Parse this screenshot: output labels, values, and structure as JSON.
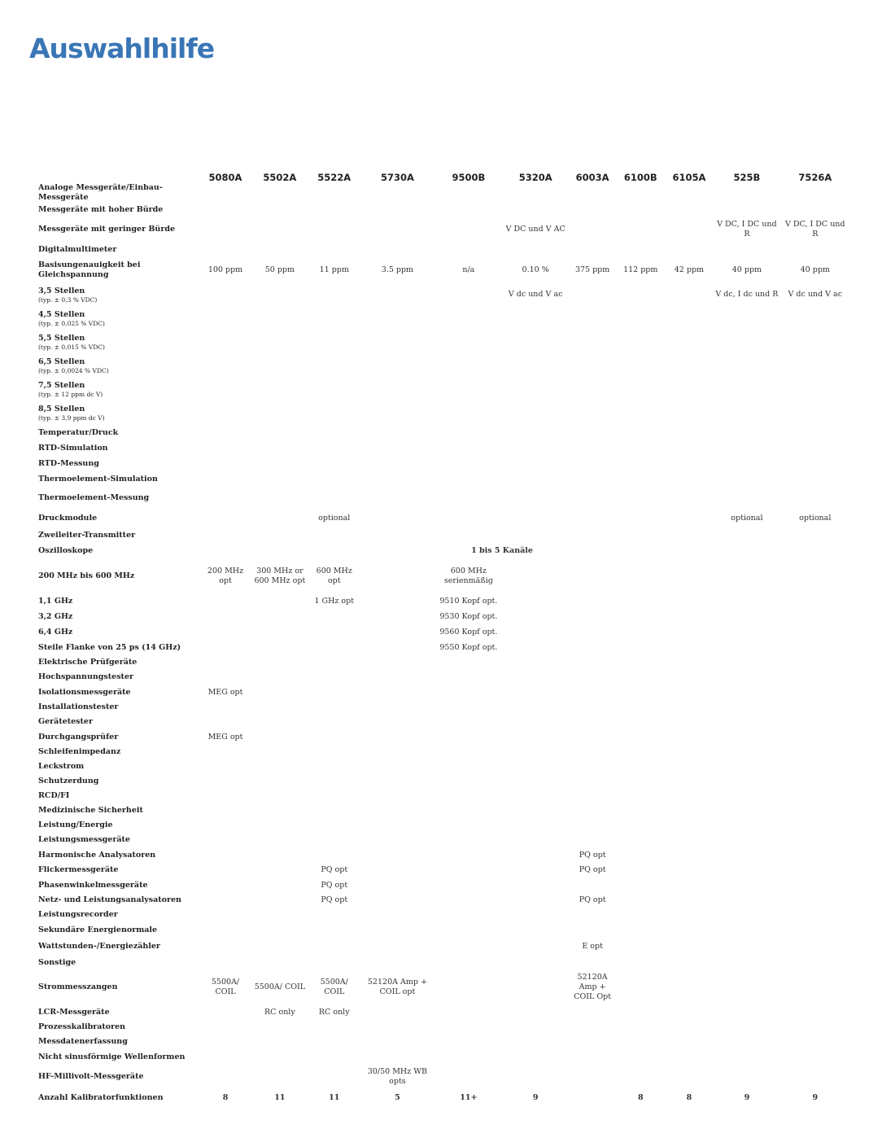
{
  "title": "Auswahlhilfe",
  "columns": [
    "5080A",
    "5502A",
    "5522A",
    "5730A",
    "9500B",
    "5320A",
    "6003A",
    "6100B",
    "6105A",
    "525B",
    "7526A"
  ],
  "rows": [
    {
      "label": "Analoge Messgeräte/Einbau-Messgeräte",
      "h": 18,
      "cells": {}
    },
    {
      "label": "Messgeräte mit hoher Bürde",
      "h": 18,
      "cells": {}
    },
    {
      "label": "Messgeräte mit geringer Bürde",
      "h": 30,
      "cells": {
        "5": "V DC und V AC",
        "9": "V DC, I DC und R",
        "10": "V DC, I DC und R"
      }
    },
    {
      "label": "Digitalmultimeter",
      "h": 20,
      "cells": {}
    },
    {
      "label": "Basisungenauigkeit bei Gleichspannung",
      "h": 30,
      "cells": {
        "0": "100 ppm",
        "1": "50 ppm",
        "2": "11 ppm",
        "3": "3.5 ppm",
        "4": "n/a",
        "5": "0.10 %",
        "6": "375 ppm",
        "7": "112 ppm",
        "8": "42 ppm",
        "9": "40 ppm",
        "10": "40 ppm"
      }
    },
    {
      "label": "3,5 Stellen",
      "sub": "(typ. ± 0,3 % VDC)",
      "h": 30,
      "cells": {
        "5": "V dc und V ac",
        "9": "V dc, I dc und R",
        "10": "V dc und V ac"
      }
    },
    {
      "label": "4,5 Stellen",
      "sub": "(typ. ± 0,025 % VDC)",
      "h": 29,
      "cells": {}
    },
    {
      "label": "5,5 Stellen",
      "sub": "(typ. ± 0,015 % VDC)",
      "h": 29,
      "cells": {}
    },
    {
      "label": "6,5 Stellen",
      "sub": "(typ. ± 0,0024 % VDC)",
      "h": 29,
      "cells": {}
    },
    {
      "label": "7,5 Stellen",
      "sub": "(typ. ± 12 ppm dc V)",
      "h": 29,
      "cells": {}
    },
    {
      "label": "8,5 Stellen",
      "sub": "(typ. ± 3,9 ppm dc V)",
      "h": 29,
      "cells": {}
    },
    {
      "label": "Temperatur/Druck",
      "h": 19,
      "cells": {}
    },
    {
      "label": "RTD-Simulation",
      "h": 19,
      "cells": {}
    },
    {
      "label": "RTD-Messung",
      "h": 19,
      "cells": {}
    },
    {
      "label": "Thermoelement-Simulation",
      "h": 19,
      "cells": {}
    },
    {
      "label": "Thermoelement-Messung",
      "h": 28,
      "cells": {}
    },
    {
      "label": "Druckmodule",
      "h": 22,
      "cells": {
        "2": "optional",
        "9": "optional",
        "10": "optional"
      }
    },
    {
      "label": "Zweileiter-Transmitter",
      "h": 19,
      "cells": {}
    },
    {
      "label": "Oszilloskope",
      "h": 19,
      "span": {
        "start": 4,
        "len": 2,
        "text": "1 bis 5 Kanäle"
      },
      "cells": {}
    },
    {
      "label": "200 MHz bis 600 MHz",
      "h": 43,
      "cells": {
        "0": "200 MHz opt",
        "1": "300 MHz or 600 MHz opt",
        "2": "600 MHz opt",
        "4": "600 MHz serienmäßig"
      }
    },
    {
      "label": "1,1 GHz",
      "h": 19,
      "cells": {
        "2": "1 GHz opt",
        "4": "9510 Kopf opt."
      }
    },
    {
      "label": "3,2 GHz",
      "h": 19,
      "cells": {
        "4": "9530 Kopf opt."
      }
    },
    {
      "label": "6,4 GHz",
      "h": 19,
      "cells": {
        "4": "9560 Kopf opt."
      }
    },
    {
      "label": "Steile Flanke von 25 ps (14 GHz)",
      "h": 19,
      "cells": {
        "4": "9550 Kopf opt."
      }
    },
    {
      "label": "Elektrische Prüfgeräte",
      "h": 18,
      "cells": {}
    },
    {
      "label": "Hochspannungstester",
      "h": 18,
      "cells": {}
    },
    {
      "label": "Isolationsmessgeräte",
      "h": 19,
      "cells": {
        "0": "MEG opt"
      }
    },
    {
      "label": "Installationstester",
      "h": 18,
      "cells": {}
    },
    {
      "label": "Gerätetester",
      "h": 18,
      "cells": {}
    },
    {
      "label": "Durchgangsprüfer",
      "h": 19,
      "cells": {
        "0": "MEG opt"
      }
    },
    {
      "label": "Schleifenimpedanz",
      "h": 18,
      "cells": {}
    },
    {
      "label": "Leckstrom",
      "h": 18,
      "cells": {}
    },
    {
      "label": "Schutzerdung",
      "h": 18,
      "cells": {}
    },
    {
      "label": "RCD/FI",
      "h": 18,
      "cells": {}
    },
    {
      "label": "Medizinische Sicherheit",
      "h": 18,
      "cells": {}
    },
    {
      "label": "Leistung/Energie",
      "h": 18,
      "cells": {}
    },
    {
      "label": "Leistungsmessgeräte",
      "h": 18,
      "cells": {}
    },
    {
      "label": "Harmonische Analysatoren",
      "h": 19,
      "cells": {
        "6": "PQ opt"
      }
    },
    {
      "label": "Flickermessgeräte",
      "h": 18,
      "cells": {
        "2": "PQ opt",
        "6": "PQ opt"
      }
    },
    {
      "label": "Phasenwinkelmessgeräte",
      "h": 19,
      "cells": {
        "2": "PQ opt"
      }
    },
    {
      "label": "Netz- und Leistungsanalysatoren",
      "h": 18,
      "cells": {
        "2": "PQ opt",
        "6": "PQ opt"
      }
    },
    {
      "label": "Leistungsrecorder",
      "h": 18,
      "cells": {}
    },
    {
      "label": "Sekundäre Energienormale",
      "h": 19,
      "cells": {}
    },
    {
      "label": "Wattstunden-/Energiezähler",
      "h": 21,
      "cells": {
        "6": "E opt"
      }
    },
    {
      "label": "Sonstige",
      "h": 19,
      "cells": {}
    },
    {
      "label": "Strommesszangen",
      "h": 42,
      "cells": {
        "0": "5500A/ COIL",
        "1": "5500A/ COIL",
        "2": "5500A/ COIL",
        "3": "52120A Amp + COIL opt",
        "6": "52120A Amp + COIL Opt"
      }
    },
    {
      "label": "LCR-Messgeräte",
      "h": 19,
      "cells": {
        "1": "RC only",
        "2": "RC only"
      }
    },
    {
      "label": "Prozesskalibratoren",
      "h": 18,
      "cells": {}
    },
    {
      "label": "Messdatenerfassung",
      "h": 18,
      "cells": {}
    },
    {
      "label": "Nicht sinusförmige Wellenformen",
      "h": 19,
      "cells": {}
    },
    {
      "label": "HF-Millivolt-Messgeräte",
      "h": 30,
      "cells": {
        "3": "30/50 MHz WB opts"
      }
    },
    {
      "label": "Anzahl Kalibratorfunktionen",
      "h": 22,
      "total": true,
      "cells": {
        "0": "8",
        "1": "11",
        "2": "11",
        "3": "5",
        "4": "11+",
        "5": "9",
        "7": "8",
        "8": "8",
        "9": "9",
        "10": "9"
      }
    }
  ]
}
